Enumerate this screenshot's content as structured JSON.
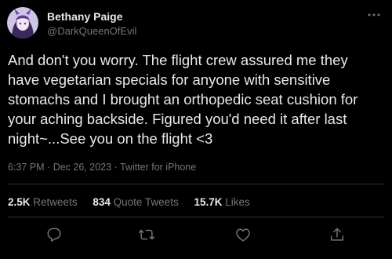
{
  "author": {
    "display_name": "Bethany Paige",
    "handle": "@DarkQueenOfEvil"
  },
  "tweet": {
    "text": "And don't you worry. The flight crew assured me they\nhave vegetarian specials for anyone with sensitive\nstomachs and I brought an orthopedic seat cushion for\nyour aching backside. Figured you'd need it after last\nnight~...See you on the flight <3",
    "time": "6:37 PM",
    "separator": "·",
    "date": "Dec 26, 2023",
    "client": "Twitter for iPhone"
  },
  "stats": {
    "retweets_count": "2.5K",
    "retweets_label": "Retweets",
    "quotes_count": "834",
    "quotes_label": "Quote Tweets",
    "likes_count": "15.7K",
    "likes_label": "Likes"
  },
  "actions": [
    {
      "icon": "reply-icon"
    },
    {
      "icon": "retweet-icon"
    },
    {
      "icon": "like-icon"
    },
    {
      "icon": "share-icon"
    }
  ],
  "colors": {
    "background": "#000000",
    "primary_text": "#e7e9ea",
    "secondary_text": "#71767b",
    "divider": "#2f3336"
  }
}
